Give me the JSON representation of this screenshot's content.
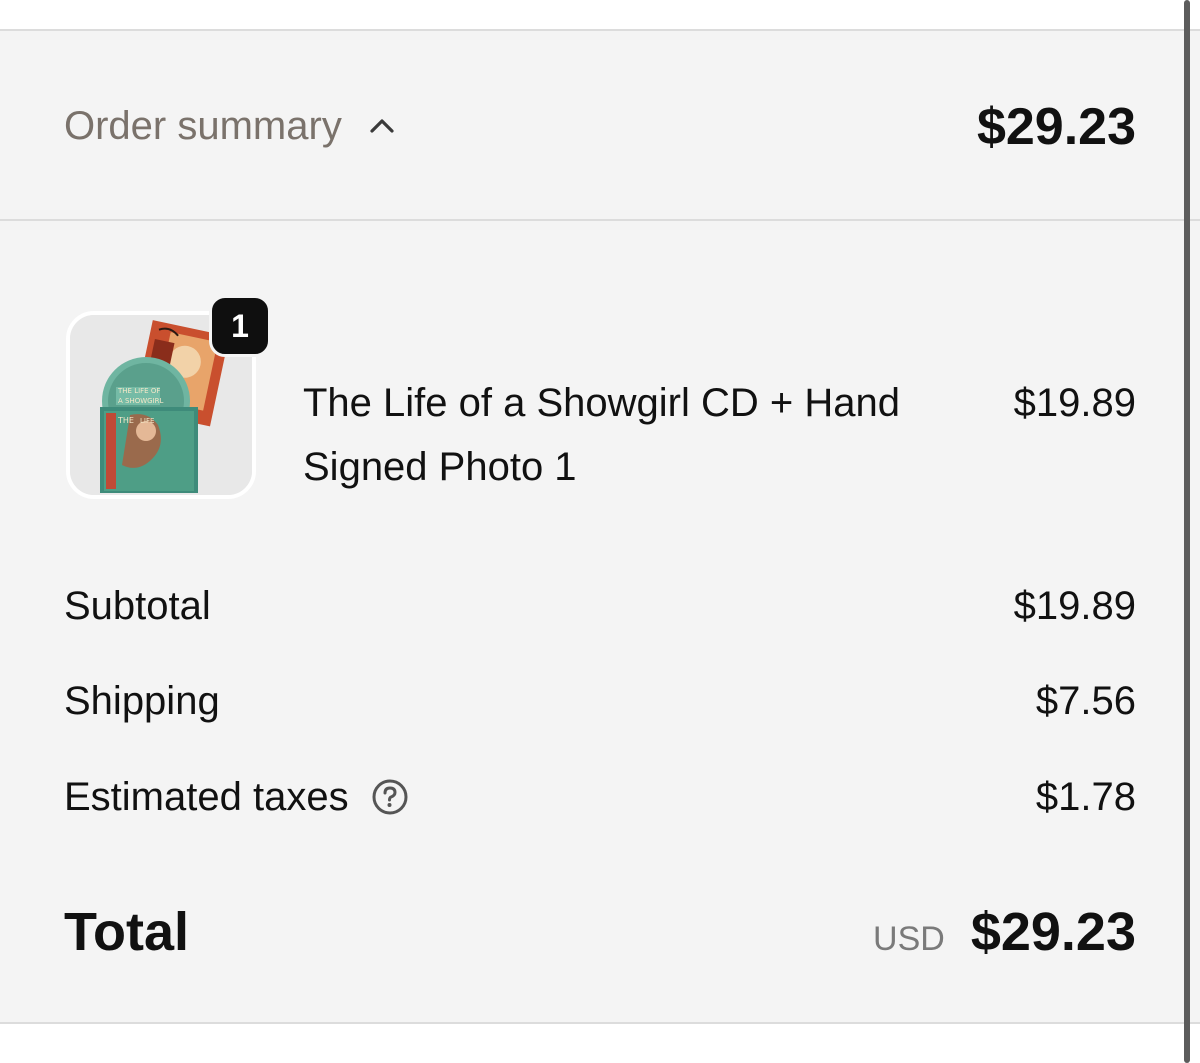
{
  "header": {
    "toggle_label": "Order summary",
    "total": "$29.23"
  },
  "item": {
    "quantity": "1",
    "name": "The Life of a Showgirl CD + Hand Signed Photo 1",
    "price": "$19.89",
    "image_alt": "album-product-image"
  },
  "summary": {
    "subtotal_label": "Subtotal",
    "subtotal_value": "$19.89",
    "shipping_label": "Shipping",
    "shipping_value": "$7.56",
    "taxes_label": "Estimated taxes",
    "taxes_value": "$1.78"
  },
  "total": {
    "label": "Total",
    "currency": "USD",
    "value": "$29.23"
  },
  "icons": {
    "toggle": "chevron-up-icon",
    "taxes_help": "question-circle-icon"
  },
  "colors": {
    "panel_background": "#f4f4f4",
    "muted_text": "#7a726b",
    "primary_text": "#111111"
  }
}
